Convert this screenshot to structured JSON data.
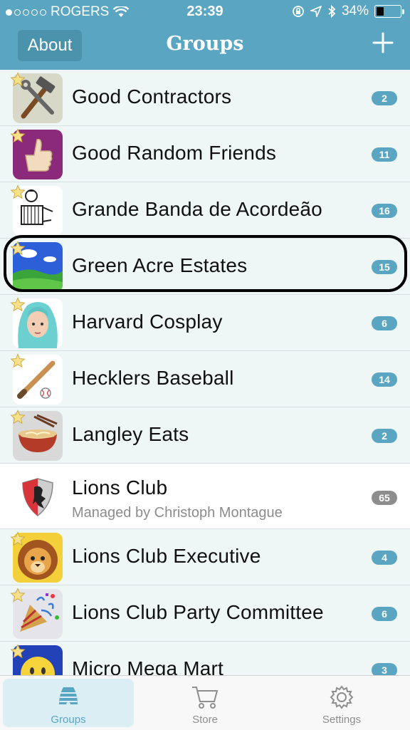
{
  "status": {
    "carrier": "ROGERS",
    "time": "23:39",
    "battery_percent": "34%",
    "battery_level": 0.34
  },
  "nav": {
    "left_button": "About",
    "title": "Groups",
    "right_icon": "plus-icon"
  },
  "groups": [
    {
      "name": "Good Contractors",
      "count": "2",
      "starred": true,
      "icon": "hammer-wrench-icon"
    },
    {
      "name": "Good Random Friends",
      "count": "11",
      "starred": true,
      "icon": "thumbs-up-icon"
    },
    {
      "name": "Grande Banda de Acordeão",
      "count": "16",
      "starred": true,
      "icon": "accordion-player-icon"
    },
    {
      "name": "Green Acre Estates",
      "count": "15",
      "starred": true,
      "icon": "green-field-icon",
      "highlighted": true
    },
    {
      "name": "Harvard Cosplay",
      "count": "6",
      "starred": true,
      "icon": "cosplay-character-icon"
    },
    {
      "name": "Hecklers Baseball",
      "count": "14",
      "starred": true,
      "icon": "baseball-bat-icon"
    },
    {
      "name": "Langley Eats",
      "count": "2",
      "starred": true,
      "icon": "noodle-bowl-icon"
    },
    {
      "name": "Lions Club",
      "subtitle": "Managed by Christoph Montague",
      "count": "65",
      "starred": false,
      "icon": "lion-shield-icon"
    },
    {
      "name": "Lions Club Executive",
      "count": "4",
      "starred": true,
      "icon": "lion-face-icon"
    },
    {
      "name": "Lions Club Party Committee",
      "count": "6",
      "starred": true,
      "icon": "party-popper-icon"
    },
    {
      "name": "Micro Mega Mart",
      "count": "3",
      "starred": true,
      "icon": "smiley-icon"
    }
  ],
  "tabs": [
    {
      "label": "Groups",
      "icon": "hive-icon",
      "active": true
    },
    {
      "label": "Store",
      "icon": "cart-icon",
      "active": false
    },
    {
      "label": "Settings",
      "icon": "gear-icon",
      "active": false
    }
  ],
  "colors": {
    "accent": "#5aa6c2",
    "row_background": "#eef6f6",
    "badge_gray": "#8d8d8d"
  }
}
